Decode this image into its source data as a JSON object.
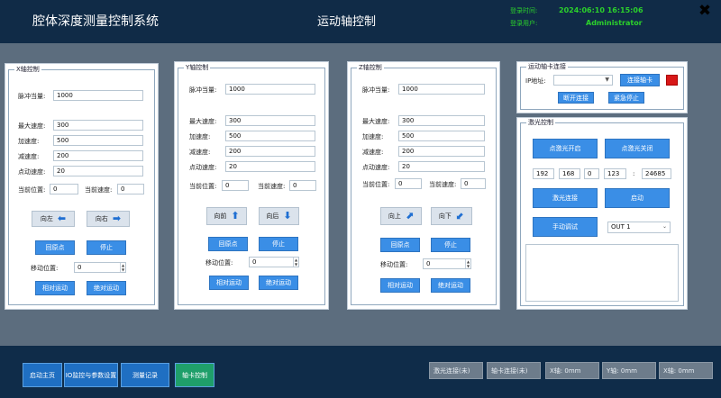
{
  "header": {
    "app_title": "腔体深度测量控制系统",
    "page_title": "运动轴控制",
    "login_time_label": "登录时间:",
    "login_time_value": "2024:06:10  16:15:06",
    "login_user_label": "登录用户:",
    "login_user_value": "Administrator",
    "close_icon": "✖"
  },
  "x_axis": {
    "title": "X轴控制",
    "pulse_label": "脉冲当量:",
    "pulse_value": "1000",
    "max_speed_label": "最大速度:",
    "max_speed_value": "300",
    "accel_label": "加速度:",
    "accel_value": "500",
    "decel_label": "减速度:",
    "decel_value": "200",
    "jog_speed_label": "点动速度:",
    "jog_speed_value": "20",
    "cur_pos_label": "当前位置:",
    "cur_pos_value": "0",
    "cur_speed_label": "当前速度:",
    "cur_speed_value": "0",
    "neg_btn": "向左",
    "neg_arrow": "⬅",
    "pos_btn": "向右",
    "pos_arrow": "➡",
    "home_btn": "回原点",
    "stop_btn": "停止",
    "move_pos_label": "移动位置:",
    "move_pos_value": "0",
    "rel_btn": "相对运动",
    "abs_btn": "绝对运动"
  },
  "y_axis": {
    "title": "Y轴控制",
    "pulse_label": "脉冲当量:",
    "pulse_value": "1000",
    "max_speed_label": "最大速度:",
    "max_speed_value": "300",
    "accel_label": "加速度:",
    "accel_value": "500",
    "decel_label": "减速度:",
    "decel_value": "200",
    "jog_speed_label": "点动速度:",
    "jog_speed_value": "20",
    "cur_pos_label": "当前位置:",
    "cur_pos_value": "0",
    "cur_speed_label": "当前速度:",
    "cur_speed_value": "0",
    "neg_btn": "向前",
    "neg_arrow": "⬆",
    "pos_btn": "向后",
    "pos_arrow": "⬇",
    "home_btn": "回原点",
    "stop_btn": "停止",
    "move_pos_label": "移动位置:",
    "move_pos_value": "0",
    "rel_btn": "相对运动",
    "abs_btn": "绝对运动"
  },
  "z_axis": {
    "title": "Z轴控制",
    "pulse_label": "脉冲当量:",
    "pulse_value": "1000",
    "max_speed_label": "最大速度:",
    "max_speed_value": "300",
    "accel_label": "加速度:",
    "accel_value": "500",
    "decel_label": "减速度:",
    "decel_value": "200",
    "jog_speed_label": "点动速度:",
    "jog_speed_value": "20",
    "cur_pos_label": "当前位置:",
    "cur_pos_value": "0",
    "cur_speed_label": "当前速度:",
    "cur_speed_value": "0",
    "neg_btn": "向上",
    "neg_arrow": "⬈",
    "pos_btn": "向下",
    "pos_arrow": "⬋",
    "home_btn": "回原点",
    "stop_btn": "停止",
    "move_pos_label": "移动位置:",
    "move_pos_value": "0",
    "rel_btn": "相对运动",
    "abs_btn": "绝对运动"
  },
  "motion_card": {
    "title": "运动轴卡连接",
    "ip_label": "IP地址:",
    "ip_value": "",
    "connect_btn": "连接轴卡",
    "disconnect_btn": "断开连接",
    "estop_btn": "紧急停止",
    "status_color": "#d81818"
  },
  "laser": {
    "title": "激光控制",
    "open_btn": "点激光开启",
    "close_btn": "点激光关闭",
    "ip_parts": [
      "192",
      "168",
      "0",
      "123"
    ],
    "ip_sep": ":",
    "port_value": "24685",
    "connect_btn": "激光连接",
    "start_btn": "启动",
    "debug_btn": "手动调试",
    "out_select": "OUT 1"
  },
  "footer": {
    "nav": [
      "启动主页",
      "IO监控与参数设置",
      "测量记录",
      "轴卡控制"
    ],
    "active_index": 3,
    "laser_status": "激光连接(未)",
    "card_status": "轴卡连接(未)",
    "x_pos": "X轴:    0mm",
    "y_pos": "Y轴:    0mm",
    "z_pos": "X轴:    0mm"
  },
  "colors": {
    "header_bg": "#102b47",
    "accent": "#3a8ee6",
    "status_green": "#2bd12b",
    "indicator_red": "#d81818"
  }
}
